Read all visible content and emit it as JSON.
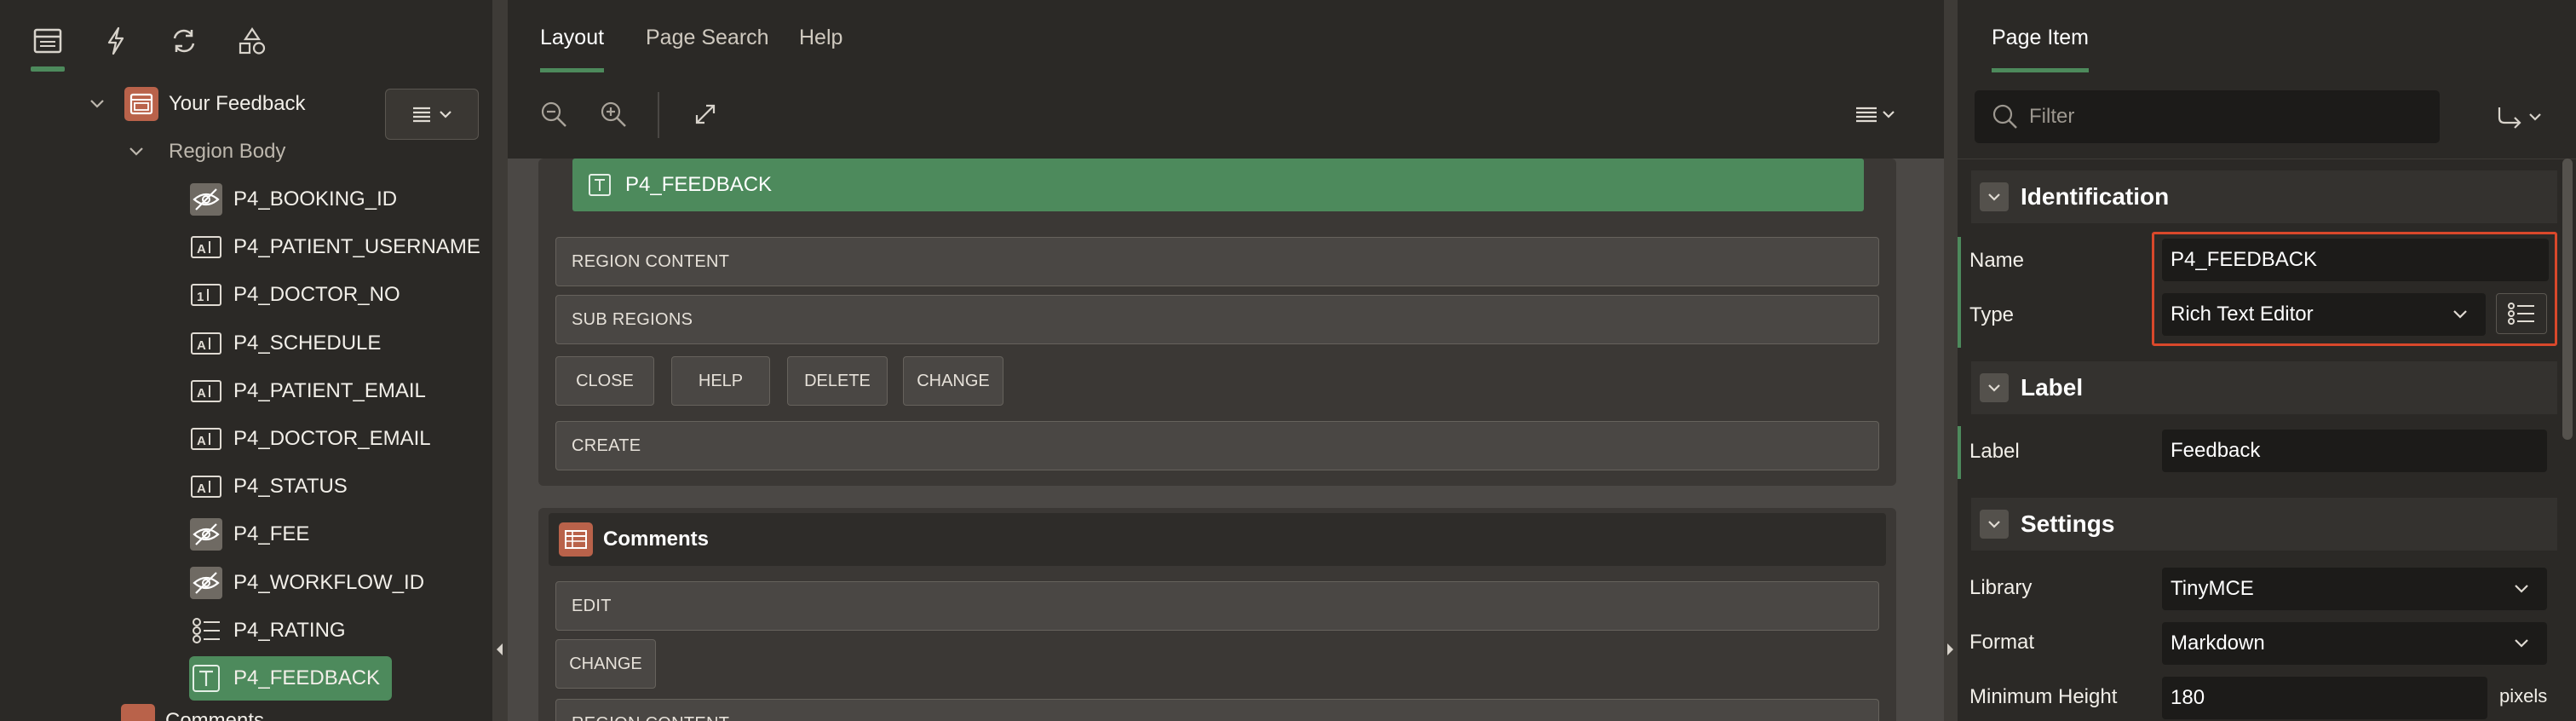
{
  "left": {
    "tree": {
      "region": "Your Feedback",
      "region_body": "Region Body",
      "items": [
        {
          "name": "P4_BOOKING_ID",
          "icon": "hidden-item-icon"
        },
        {
          "name": "P4_PATIENT_USERNAME",
          "icon": "text-field-icon"
        },
        {
          "name": "P4_DOCTOR_NO",
          "icon": "number-field-icon"
        },
        {
          "name": "P4_SCHEDULE",
          "icon": "text-field-icon"
        },
        {
          "name": "P4_PATIENT_EMAIL",
          "icon": "text-field-icon"
        },
        {
          "name": "P4_DOCTOR_EMAIL",
          "icon": "text-field-icon"
        },
        {
          "name": "P4_STATUS",
          "icon": "text-field-icon"
        },
        {
          "name": "P4_FEE",
          "icon": "hidden-item-icon"
        },
        {
          "name": "P4_WORKFLOW_ID",
          "icon": "hidden-item-icon"
        },
        {
          "name": "P4_RATING",
          "icon": "radio-group-icon"
        },
        {
          "name": "P4_FEEDBACK",
          "icon": "textarea-icon"
        }
      ],
      "next_region_partial": "Comments"
    }
  },
  "middle": {
    "tabs": [
      "Layout",
      "Page Search",
      "Help"
    ],
    "canvas": {
      "feedback_item": "P4_FEEDBACK",
      "region_content": "REGION CONTENT",
      "sub_regions": "SUB REGIONS",
      "buttons": [
        "CLOSE",
        "HELP",
        "DELETE",
        "CHANGE"
      ],
      "create": "CREATE",
      "comments_region": "Comments",
      "edit": "EDIT",
      "change": "CHANGE",
      "region_content_2": "REGION CONTENT"
    }
  },
  "right": {
    "tab": "Page Item",
    "filter_placeholder": "Filter",
    "identification": {
      "title": "Identification",
      "name_label": "Name",
      "name_value": "P4_FEEDBACK",
      "type_label": "Type",
      "type_value": "Rich Text Editor"
    },
    "label_section": {
      "title": "Label",
      "label_label": "Label",
      "label_value": "Feedback"
    },
    "settings": {
      "title": "Settings",
      "library_label": "Library",
      "library_value": "TinyMCE",
      "format_label": "Format",
      "format_value": "Markdown",
      "min_height_label": "Minimum Height",
      "min_height_value": "180",
      "min_height_unit": "pixels"
    }
  },
  "colors": {
    "accent_green": "#4d8a5c",
    "highlight_red": "#d9482b",
    "region_icon": "#b9624a"
  }
}
